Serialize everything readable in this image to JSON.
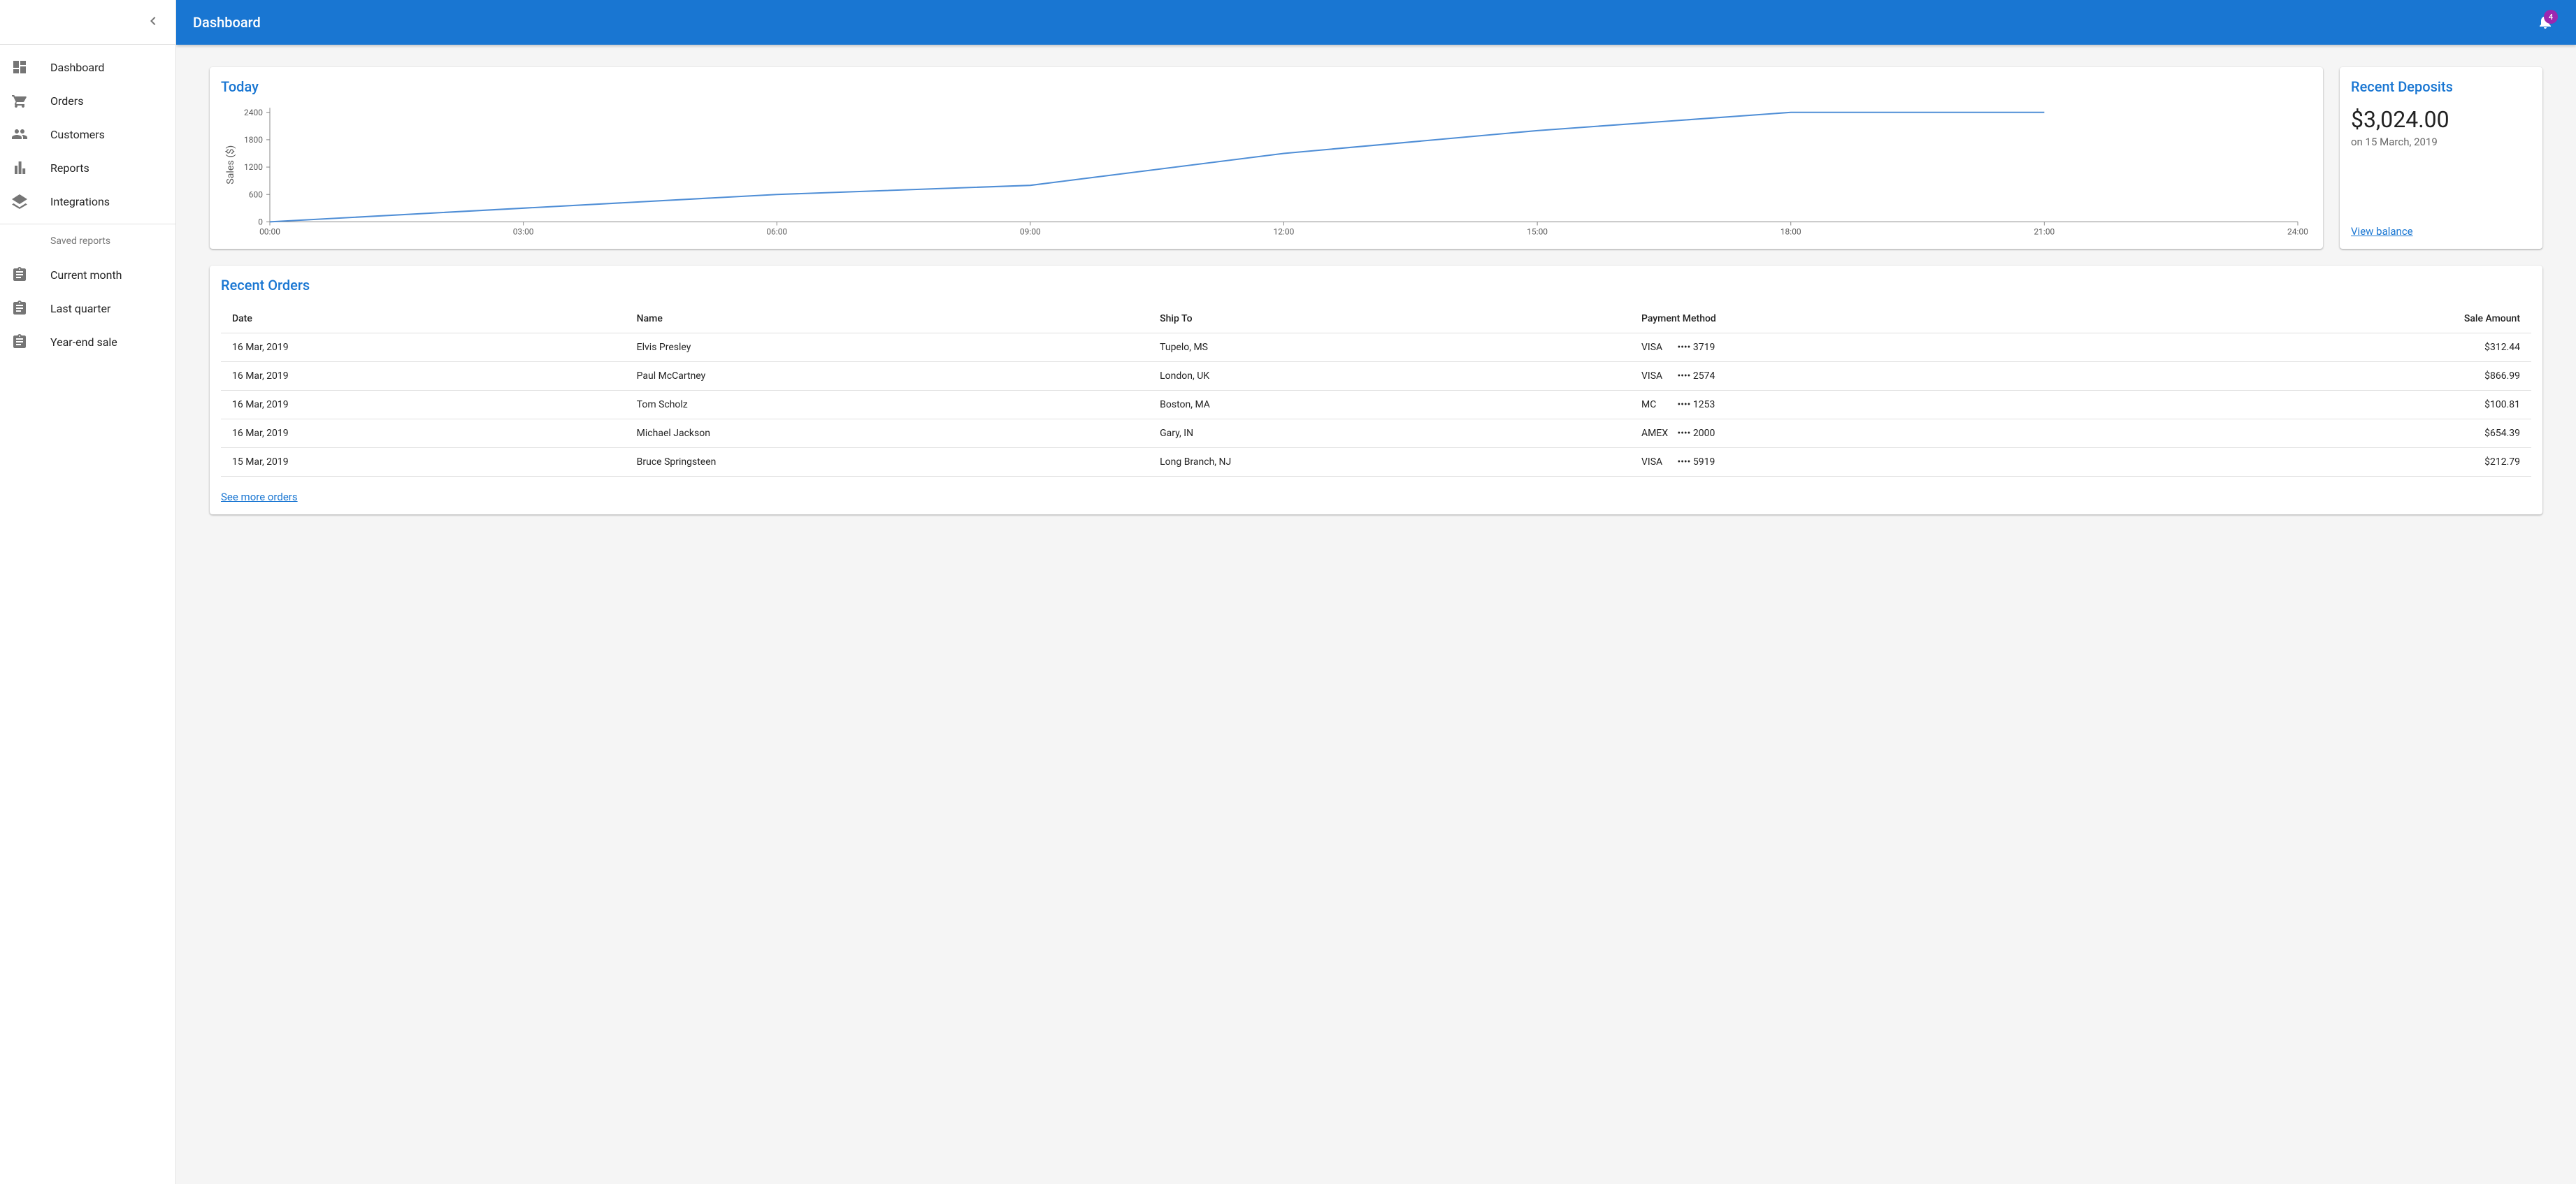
{
  "app": {
    "title": "Dashboard",
    "notifications_count": "4"
  },
  "sidebar": {
    "items": [
      {
        "label": "Dashboard",
        "icon": "dashboard-icon"
      },
      {
        "label": "Orders",
        "icon": "cart-icon"
      },
      {
        "label": "Customers",
        "icon": "people-icon"
      },
      {
        "label": "Reports",
        "icon": "bar-chart-icon"
      },
      {
        "label": "Integrations",
        "icon": "layers-icon"
      }
    ],
    "subheader": "Saved reports",
    "saved": [
      {
        "label": "Current month",
        "icon": "assignment-icon"
      },
      {
        "label": "Last quarter",
        "icon": "assignment-icon"
      },
      {
        "label": "Year-end sale",
        "icon": "assignment-icon"
      }
    ]
  },
  "chart": {
    "title": "Today"
  },
  "chart_data": {
    "type": "line",
    "title": "Today",
    "xlabel": "",
    "ylabel": "Sales ($)",
    "x_ticks": [
      "00:00",
      "03:00",
      "06:00",
      "09:00",
      "12:00",
      "15:00",
      "18:00",
      "21:00",
      "24:00"
    ],
    "y_ticks": [
      0,
      600,
      1200,
      1800,
      2400
    ],
    "ylim": [
      0,
      2500
    ],
    "x": [
      "00:00",
      "03:00",
      "06:00",
      "09:00",
      "12:00",
      "15:00",
      "18:00",
      "21:00"
    ],
    "y": [
      0,
      300,
      600,
      800,
      1500,
      2000,
      2400,
      2400
    ]
  },
  "deposits": {
    "title": "Recent Deposits",
    "amount": "$3,024.00",
    "date": "on 15 March, 2019",
    "link": "View balance"
  },
  "orders": {
    "title": "Recent Orders",
    "columns": [
      "Date",
      "Name",
      "Ship To",
      "Payment Method",
      "Sale Amount"
    ],
    "rows": [
      {
        "date": "16 Mar, 2019",
        "name": "Elvis Presley",
        "ship": "Tupelo, MS",
        "pay_brand": "VISA",
        "pay_last": "•••• 3719",
        "amount": "$312.44"
      },
      {
        "date": "16 Mar, 2019",
        "name": "Paul McCartney",
        "ship": "London, UK",
        "pay_brand": "VISA",
        "pay_last": "•••• 2574",
        "amount": "$866.99"
      },
      {
        "date": "16 Mar, 2019",
        "name": "Tom Scholz",
        "ship": "Boston, MA",
        "pay_brand": "MC",
        "pay_last": "•••• 1253",
        "amount": "$100.81"
      },
      {
        "date": "16 Mar, 2019",
        "name": "Michael Jackson",
        "ship": "Gary, IN",
        "pay_brand": "AMEX",
        "pay_last": "•••• 2000",
        "amount": "$654.39"
      },
      {
        "date": "15 Mar, 2019",
        "name": "Bruce Springsteen",
        "ship": "Long Branch, NJ",
        "pay_brand": "VISA",
        "pay_last": "•••• 5919",
        "amount": "$212.79"
      }
    ],
    "link": "See more orders"
  }
}
